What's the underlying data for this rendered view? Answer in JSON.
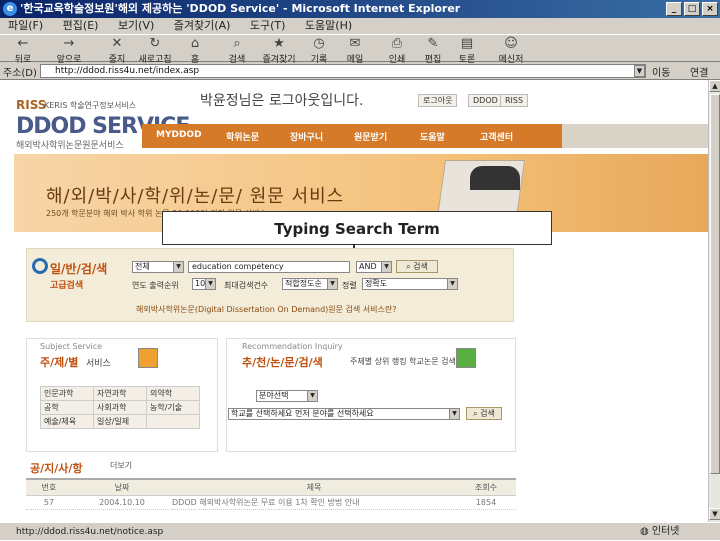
{
  "window": {
    "title": "'한국교육학술정보원'해외 제공하는 'DDOD Service' - Microsoft Internet Explorer"
  },
  "menu": [
    "파일(F)",
    "편집(E)",
    "보기(V)",
    "즐겨찾기(A)",
    "도구(T)",
    "도움말(H)"
  ],
  "toolbar": [
    "뒤로",
    "앞으로",
    "중지",
    "새로고침",
    "홈",
    "검색",
    "즐겨찾기",
    "기록",
    "메일",
    "인쇄",
    "편집",
    "토론",
    "메신저"
  ],
  "address": {
    "label": "주소(D)",
    "url": "http://ddod.riss4u.net/index.asp",
    "go": "이동",
    "links": "연결"
  },
  "site": {
    "logo_small": "RISS",
    "logo_sub": "KERIS 학술연구정보서비스",
    "logo_main": "DDOD SERVICE",
    "logo_kor": "해외박사학위논문원문서비스",
    "welcome": "박윤정님은 로그아웃입니다.",
    "top_buttons": [
      "로그아웃",
      "DDOD",
      "RISS"
    ],
    "nav": [
      "MYDDOD",
      "학위논문",
      "장바구니",
      "원문받기",
      "도움말",
      "고객센터"
    ],
    "banner_title": "해/외/박/사/학/위/논/문/ 원문 서비스",
    "banner_sub": "250개 학문분야 해외 박사 학위 논문 20,000여 건의 원문 서비스"
  },
  "callout": "Typing Search Term",
  "search": {
    "title": "일/반/검/색",
    "advanced": "고급검색",
    "field_select": "전체",
    "term": "education competency",
    "op_select": "AND",
    "search_btn": "검색",
    "label_year": "연도 출력순위",
    "year_select": "10",
    "label_sort": "최대검색건수",
    "sort_select": "적합정도순",
    "label_order": "정렬",
    "order_select": "정확도",
    "note": "해외박사학위논문(Digital Dissertation On Demand)원문 검색 서비스란?"
  },
  "subject": {
    "en": "Subject Service",
    "ko": "주/제/별",
    "ko2": "서비스",
    "cells": [
      [
        "인문과학",
        "자연과학",
        "의약학"
      ],
      [
        "공학",
        "사회과학",
        "농학/기술"
      ],
      [
        "예술/체육",
        "일상/일제",
        ""
      ]
    ]
  },
  "recommend": {
    "en": "Recommendation Inquiry",
    "ko": "추/천/논/문/검/색",
    "desc": "주제별 상위 랭킹 학교논문 검색",
    "select1": "분야선택",
    "select2": "학교를 선택하세요 먼저 분야를 선택하세요",
    "btn": "검색"
  },
  "notice": {
    "title": "공/지/사/항",
    "more": "더보기",
    "cols": [
      "번호",
      "날짜",
      "제목",
      "조회수"
    ],
    "row": [
      "57",
      "2004.10.10",
      "DDOD 해외박사학위논문 무료 이용 1차 확인 방법 안내",
      "1854"
    ]
  },
  "status": {
    "url": "http://ddod.riss4u.net/notice.asp",
    "zone": "인터넷"
  }
}
